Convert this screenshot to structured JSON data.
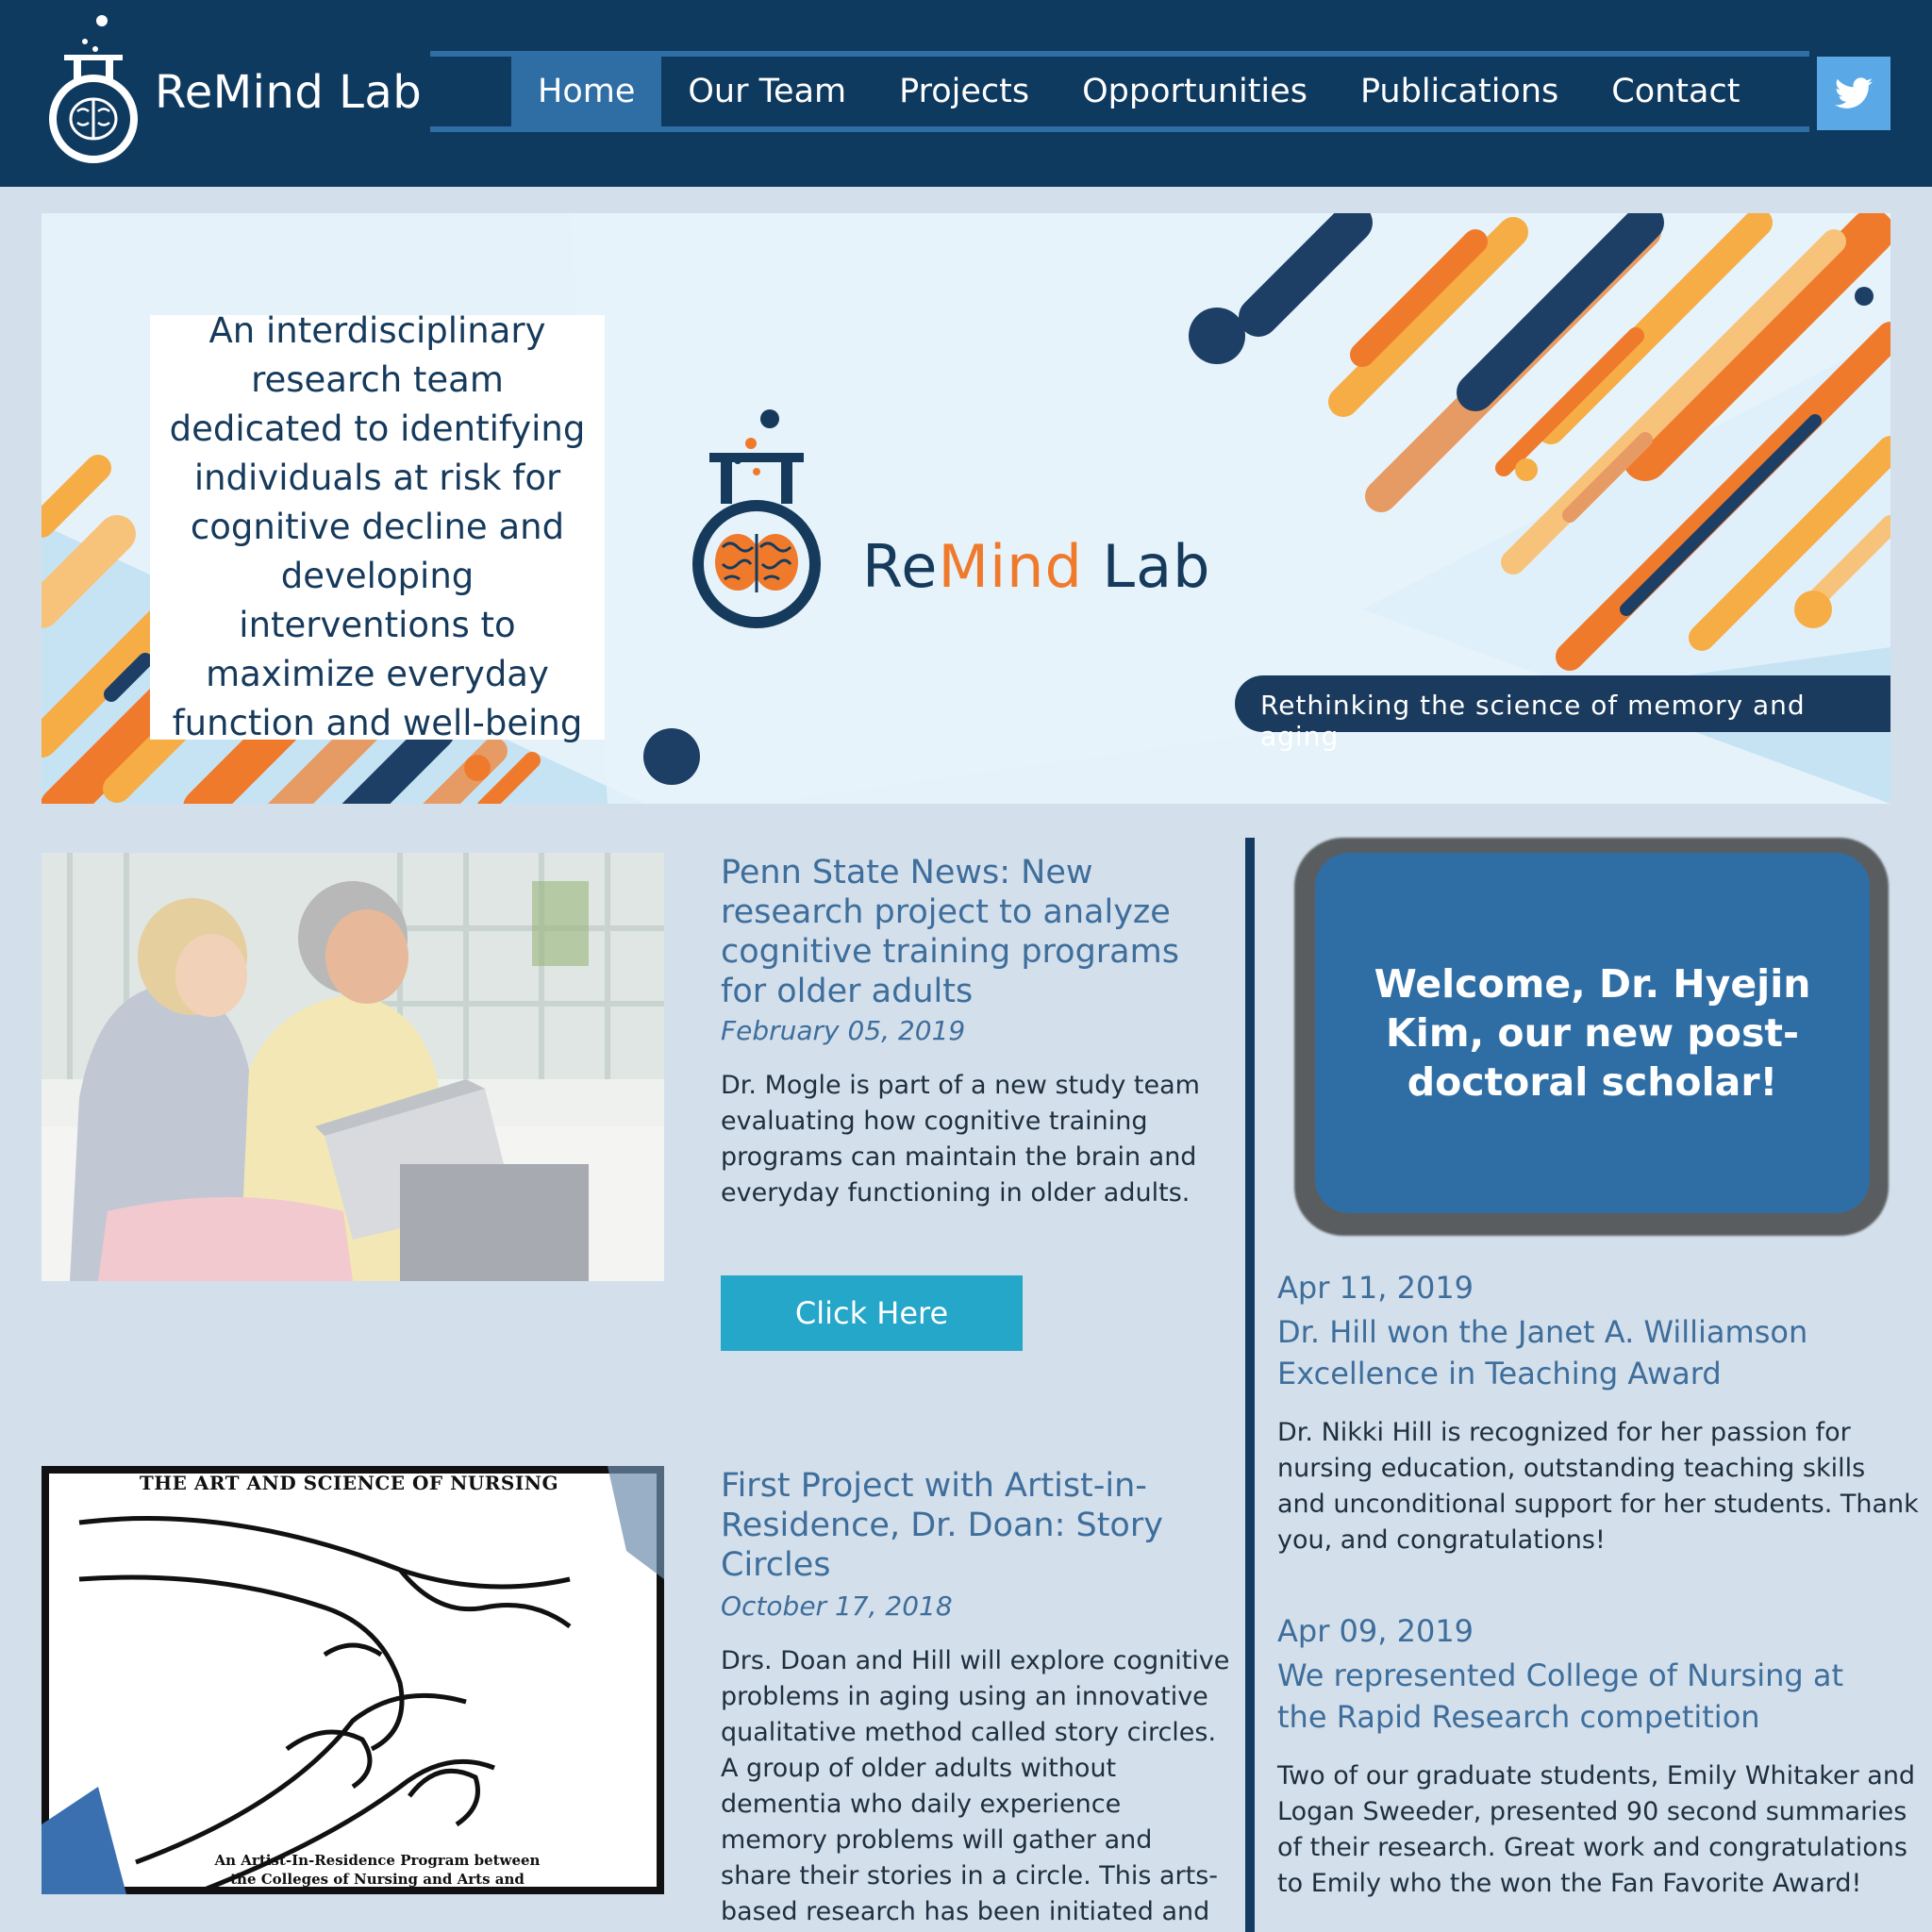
{
  "header": {
    "brand": "ReMind Lab",
    "nav": [
      "Home",
      "Our Team",
      "Projects",
      "Opportunities",
      "Publications",
      "Contact"
    ],
    "active_nav": "Home",
    "social_icon": "twitter-icon"
  },
  "hero": {
    "mission": "An interdisciplinary research team dedicated to identifying individuals at risk for cognitive decline and developing interventions to maximize everyday function and well-being",
    "brand_re": "Re",
    "brand_mind": "Mind",
    "brand_lab": " Lab",
    "tagline": "Rethinking the science of memory and aging"
  },
  "news": [
    {
      "title": "Penn State News: New research project to analyze cognitive training programs for older adults",
      "date": "February 05, 2019",
      "body": "Dr. Mogle is part of a new study team evaluating how cognitive training programs can maintain the brain and everyday functioning in older adults.",
      "button": "Click Here"
    },
    {
      "title": "First Project with Artist-in-Residence, Dr. Doan: Story Circles",
      "date": "October 17, 2018",
      "body": "Drs. Doan and Hill will explore cognitive problems in aging using an innovative qualitative method called story circles. A group of older adults without dementia who daily experience memory problems will gather and share their stories in a circle. This arts-based research has been initiated and will help",
      "image_caption_top": "THE ART AND SCIENCE OF NURSING",
      "image_caption_bottom": "An Artist-In-Residence Program between the Colleges of Nursing and Arts and"
    }
  ],
  "welcome": "Welcome, Dr. Hyejin Kim, our new post-doctoral scholar!",
  "posts": [
    {
      "date": "Apr 11, 2019",
      "title": "Dr. Hill won the Janet A. Williamson Excellence in Teaching Award",
      "body": "Dr. Nikki Hill is recognized for her passion for nursing education, outstanding teaching skills and unconditional support for her students. Thank you, and congratulations!"
    },
    {
      "date": "Apr 09, 2019",
      "title": "We represented College of Nursing at the Rapid Research competition",
      "body": "Two of our graduate students, Emily Whitaker and Logan Sweeder, presented 90 second summaries of their research. Great work and congratulations to Emily who the won the Fan Favorite Award!"
    }
  ],
  "colors": {
    "header_bg": "#0f3a60",
    "nav_active": "#2f6ea5",
    "page_bg": "#d3dfea",
    "accent_orange": "#f07a2c",
    "button": "#24a7c8",
    "link_blue": "#3e6e9c"
  }
}
